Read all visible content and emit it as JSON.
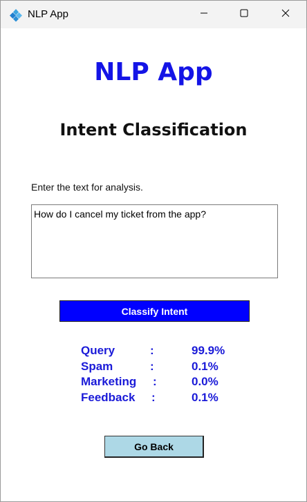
{
  "window": {
    "title": "NLP App",
    "icon": "diamond-app-icon",
    "controls": {
      "minimize": "minimize-icon",
      "maximize": "maximize-icon",
      "close": "close-icon"
    }
  },
  "header": {
    "app_title": "NLP App",
    "subtitle": "Intent Classification"
  },
  "form": {
    "prompt_label": "Enter the text for analysis.",
    "input_value": "How do I cancel my ticket from the app?",
    "classify_label": "Classify Intent"
  },
  "results": [
    {
      "label": "Query",
      "colon": ":",
      "value": "99.9%"
    },
    {
      "label": "Spam",
      "colon": ":",
      "value": "0.1%"
    },
    {
      "label": "Marketing",
      "colon": ":",
      "value": "0.0%"
    },
    {
      "label": "Feedback",
      "colon": ":",
      "value": "0.1%"
    }
  ],
  "footer": {
    "back_label": "Go Back"
  },
  "colors": {
    "title_blue": "#1414e6",
    "classify_button": "#0000ff",
    "result_text": "#1a1ad8",
    "back_button": "#add8e6"
  }
}
